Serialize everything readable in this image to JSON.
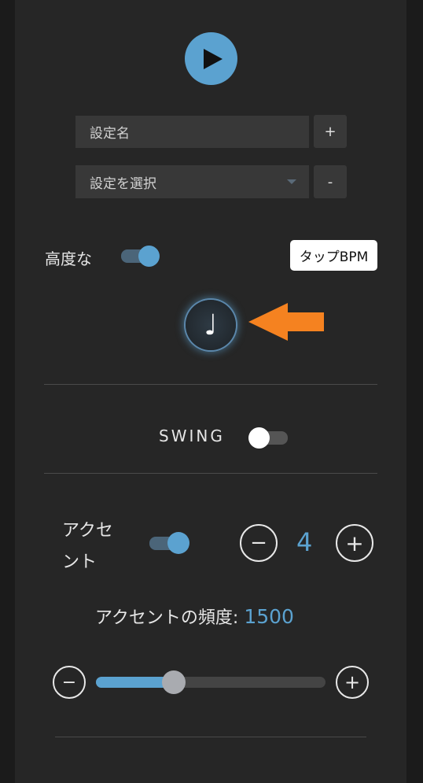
{
  "controls": {
    "setting_name_placeholder": "設定名",
    "add_label": "+",
    "select_label": "設定を選択",
    "remove_label": "-"
  },
  "advanced": {
    "label": "高度な",
    "enabled": true,
    "tap_bpm_label": "タップBPM"
  },
  "note_button": {
    "glyph": "♩"
  },
  "swing": {
    "label": "SWING",
    "enabled": false
  },
  "accent": {
    "label_line1": "アクセ",
    "label_line2": "ント",
    "enabled": true,
    "value": "4",
    "decrement_glyph": "−",
    "increment_glyph": "+"
  },
  "frequency": {
    "label": "アクセントの頻度:",
    "value": "1500",
    "slider_fraction": 0.34
  },
  "colors": {
    "accent": "#5ba2d0",
    "arrow": "#f58220",
    "panel": "#262626"
  }
}
